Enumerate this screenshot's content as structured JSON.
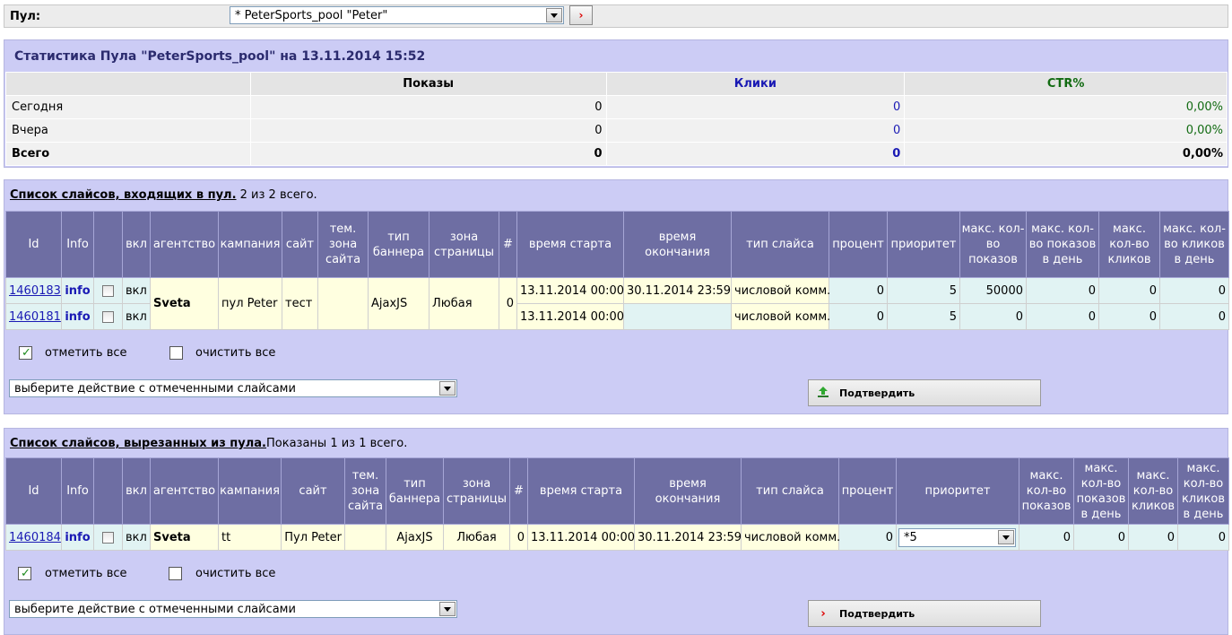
{
  "pool": {
    "label": "Пул:",
    "selected": "* PeterSports_pool \"Peter\"",
    "go_icon": "arrow-right-icon"
  },
  "stats": {
    "title": "Статистика Пула \"PeterSports_pool\" на 13.11.2014 15:52",
    "headers": {
      "views": "Показы",
      "clicks": "Клики",
      "ctr": "CTR%"
    },
    "rows": [
      {
        "label": "Сегодня",
        "views": "0",
        "clicks": "0",
        "ctr": "0,00%"
      },
      {
        "label": "Вчера",
        "views": "0",
        "clicks": "0",
        "ctr": "0,00%"
      },
      {
        "label": "Всего",
        "views": "0",
        "clicks": "0",
        "ctr": "0,00%"
      }
    ]
  },
  "included": {
    "title": "Список слайсов, входящих в пул.",
    "count": " 2 из 2 всего.",
    "headers": {
      "id": "Id",
      "info": "Info",
      "on": "вкл",
      "agency": "агентство",
      "campaign": "кампания",
      "site": "сайт",
      "theme": "тем. зона сайта",
      "banner": "тип баннера",
      "zone": "зона страницы",
      "num": "#",
      "start": "время старта",
      "end": "время окончания",
      "slice_type": "тип слайса",
      "percent": "процент",
      "priority": "приоритет",
      "max_views": "макс. кол-во показов",
      "max_views_day": "макс. кол-во показов в день",
      "max_clicks": "макс. кол-во кликов",
      "max_clicks_day": "макс. кол-во кликов в день"
    },
    "agency": "Sveta",
    "campaign": "пул Peter",
    "site": "тест",
    "banner": "AjaxJS",
    "zone": "Любая",
    "num": "0",
    "rows": [
      {
        "id": "1460183",
        "info": "info",
        "on": "вкл",
        "start": "13.11.2014 00:00",
        "end": "30.11.2014 23:59",
        "slice_type": "числовой комм.",
        "percent": "0",
        "priority": "5",
        "max_views": "50000",
        "max_views_day": "0",
        "max_clicks": "0",
        "max_clicks_day": "0"
      },
      {
        "id": "1460181",
        "info": "info",
        "on": "вкл",
        "start": "13.11.2014 00:00",
        "end": "",
        "slice_type": "числовой комм.",
        "percent": "0",
        "priority": "5",
        "max_views": "0",
        "max_views_day": "0",
        "max_clicks": "0",
        "max_clicks_day": "0"
      }
    ],
    "check_all": "отметить все",
    "clear_all": "очистить все",
    "action_select": "выберите действие с отмеченными слайсами",
    "confirm": "Подтвердить",
    "confirm_icon": "upload-arrow-icon"
  },
  "excluded": {
    "title": "Список слайсов, вырезанных из пула.",
    "count": "Показаны  1 из 1 всего.",
    "headers": {
      "id": "Id",
      "info": "Info",
      "on": "вкл",
      "agency": "агентство",
      "campaign": "кампания",
      "site": "сайт",
      "theme": "тем. зона сайта",
      "banner": "тип баннера",
      "zone": "зона страницы",
      "num": "#",
      "start": "время старта",
      "end": "время окончания",
      "slice_type": "тип слайса",
      "percent": "процент",
      "priority": "приоритет",
      "max_views": "макс. кол-во показов",
      "max_views_day": "макс. кол-во показов в день",
      "max_clicks": "макс. кол-во кликов",
      "max_clicks_day": "макс. кол-во кликов в день"
    },
    "row": {
      "id": "1460184",
      "info": "info",
      "on": "вкл",
      "agency": "Sveta",
      "campaign": "tt",
      "site": "Пул Peter",
      "banner": "AjaxJS",
      "zone": "Любая",
      "num": "0",
      "start": "13.11.2014 00:00",
      "end": "30.11.2014 23:59",
      "slice_type": "числовой комм.",
      "percent": "0",
      "priority_select": "*5",
      "max_views": "0",
      "max_views_day": "0",
      "max_clicks": "0",
      "max_clicks_day": "0"
    },
    "check_all": "отметить все",
    "clear_all": "очистить все",
    "action_select": "выберите действие с отмеченными слайсами",
    "confirm": "Подтвердить",
    "confirm_icon": "arrow-right-icon"
  }
}
